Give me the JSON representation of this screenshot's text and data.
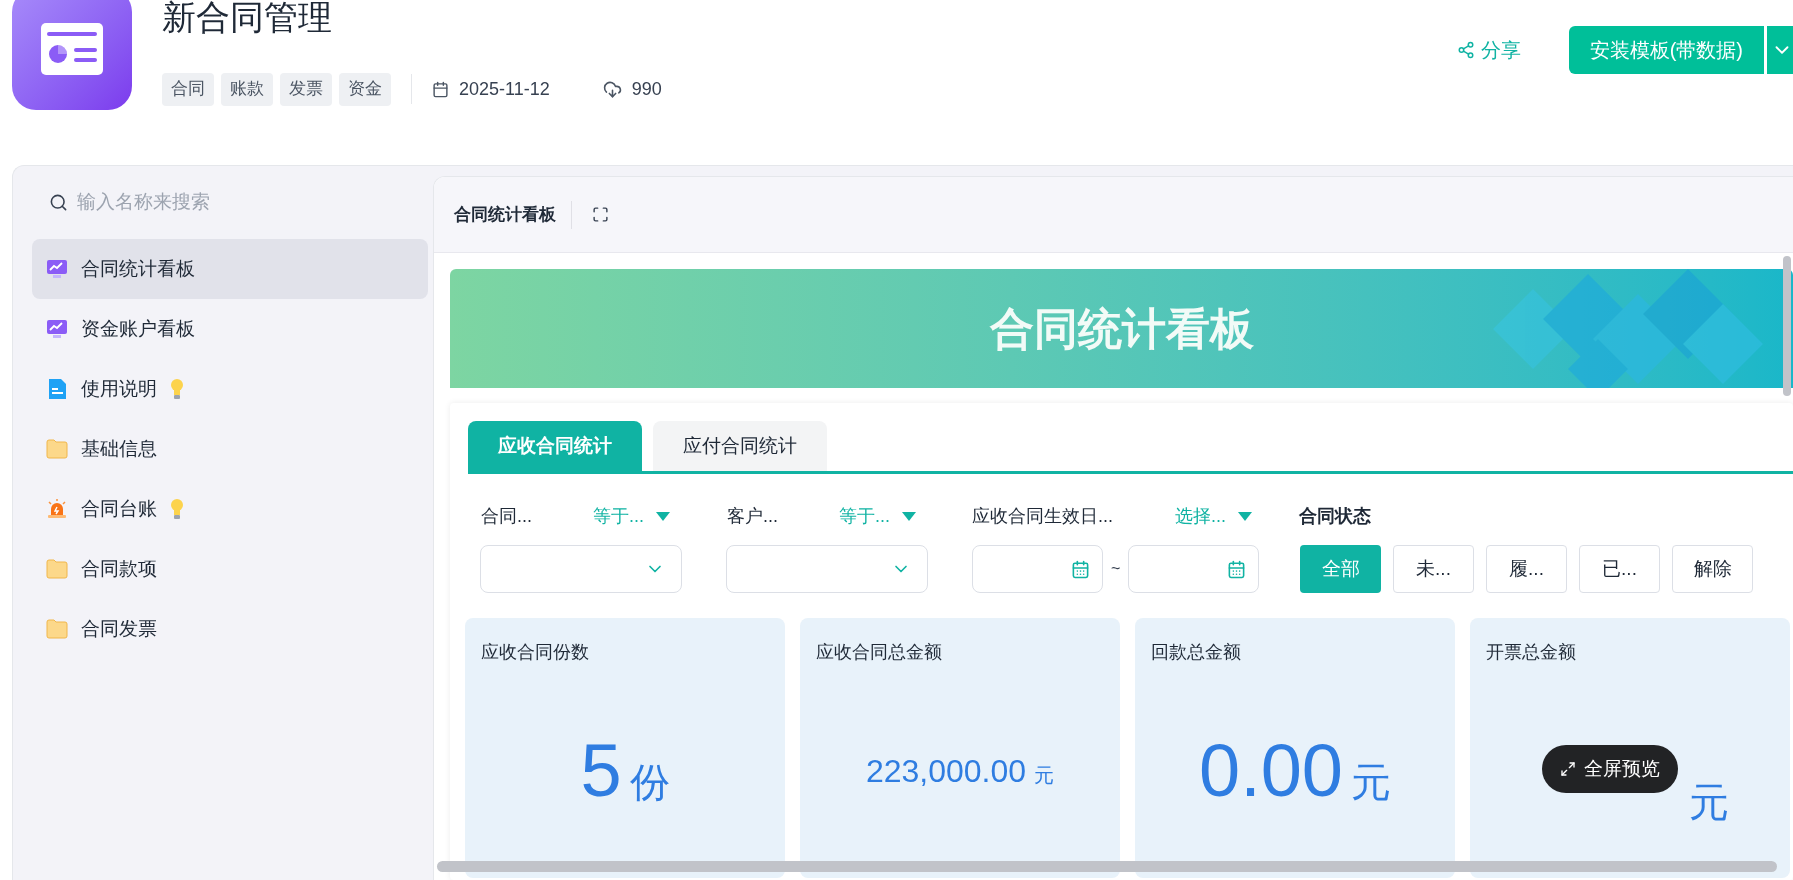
{
  "app": {
    "title": "新合同管理",
    "tags": [
      "合同",
      "账款",
      "发票",
      "资金"
    ],
    "date": "2025-11-12",
    "downloads": "990"
  },
  "actions": {
    "share": "分享",
    "install": "安装模板(带数据)"
  },
  "sidebar": {
    "search_placeholder": "输入名称来搜索",
    "items": [
      {
        "label": "合同统计看板",
        "kind": "dashboard",
        "tip": false,
        "selected": true
      },
      {
        "label": "资金账户看板",
        "kind": "dashboard",
        "tip": false,
        "selected": false
      },
      {
        "label": "使用说明",
        "kind": "doc",
        "tip": true,
        "selected": false
      },
      {
        "label": "基础信息",
        "kind": "folder",
        "tip": false,
        "selected": false
      },
      {
        "label": "合同台账",
        "kind": "alert",
        "tip": true,
        "selected": false
      },
      {
        "label": "合同款项",
        "kind": "folder",
        "tip": false,
        "selected": false
      },
      {
        "label": "合同发票",
        "kind": "folder",
        "tip": false,
        "selected": false
      }
    ]
  },
  "panel": {
    "title": "合同统计看板"
  },
  "banner": {
    "title": "合同统计看板"
  },
  "tabs": [
    {
      "label": "应收合同统计",
      "selected": true
    },
    {
      "label": "应付合同统计",
      "selected": false
    }
  ],
  "filters": [
    {
      "kind": "select",
      "label": "合同...",
      "operator": "等于..."
    },
    {
      "kind": "select",
      "label": "客户...",
      "operator": "等于..."
    },
    {
      "kind": "date_range",
      "label": "应收合同生效日...",
      "operator": "选择...",
      "separator": "~"
    }
  ],
  "status_filter": {
    "label": "合同状态",
    "options": [
      {
        "label": "全部",
        "selected": true
      },
      {
        "label": "未...",
        "selected": false
      },
      {
        "label": "履...",
        "selected": false
      },
      {
        "label": "已...",
        "selected": false
      },
      {
        "label": "解除",
        "selected": false
      }
    ]
  },
  "stats": [
    {
      "label": "应收合同份数",
      "value": "5",
      "unit": "份"
    },
    {
      "label": "应收合同总金额",
      "value": "223,000.00",
      "unit": "元"
    },
    {
      "label": "回款总金额",
      "value": "0.00",
      "unit": "元"
    },
    {
      "label": "开票总金额",
      "unit": "元"
    }
  ],
  "fullscreen_button": "全屏预览"
}
